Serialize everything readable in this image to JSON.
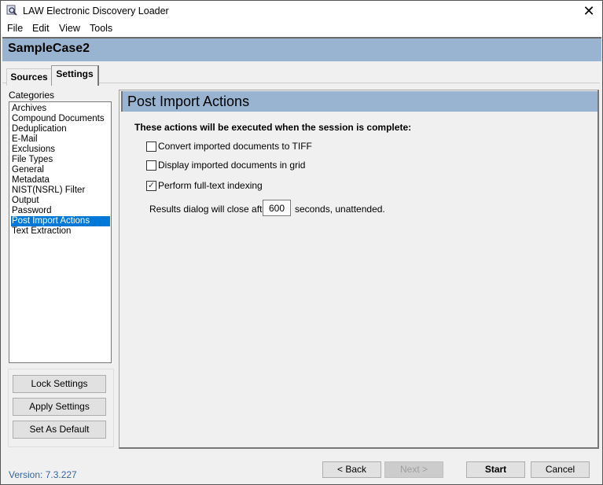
{
  "window": {
    "title": "LAW Electronic Discovery Loader",
    "close_symbol": "✕"
  },
  "menu": [
    "File",
    "Edit",
    "View",
    "Tools"
  ],
  "case": {
    "name": "SampleCase2"
  },
  "tabs": [
    {
      "label": "Sources",
      "active": false
    },
    {
      "label": "Settings",
      "active": true
    }
  ],
  "categories": {
    "label": "Categories",
    "items": [
      "Archives",
      "Compound Documents",
      "Deduplication",
      "E-Mail",
      "Exclusions",
      "File Types",
      "General",
      "Metadata",
      "NIST(NSRL) Filter",
      "Output",
      "Password",
      "Post Import Actions",
      "Text Extraction"
    ],
    "selected": "Post Import Actions"
  },
  "left_buttons": {
    "lock": "Lock Settings",
    "apply": "Apply Settings",
    "default": "Set As Default"
  },
  "panel": {
    "title": "Post Import Actions",
    "intro": "These actions will be executed when the session is complete:",
    "options": [
      {
        "label": "Convert imported documents to TIFF",
        "checked": false,
        "mark": ""
      },
      {
        "label": "Display imported documents in grid",
        "checked": false,
        "mark": ""
      },
      {
        "label": "Perform full-text indexing",
        "checked": true,
        "mark": "✓"
      }
    ],
    "results_prefix": "Results dialog will close after",
    "results_value": "600",
    "results_suffix": "seconds, unattended."
  },
  "footer": {
    "version": "Version: 7.3.227",
    "back": "< Back",
    "next": "Next >",
    "start": "Start",
    "cancel": "Cancel"
  }
}
